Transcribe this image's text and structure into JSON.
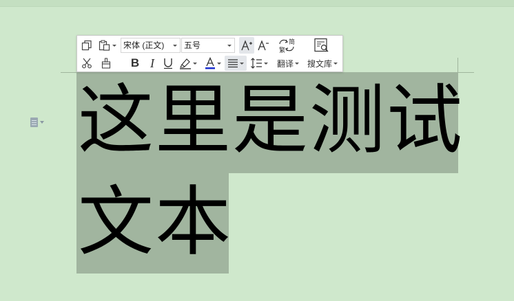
{
  "document": {
    "line1": "这里是测试",
    "line2": "文本"
  },
  "toolbar": {
    "font_name": "宋体 (正文)",
    "font_size": "五号",
    "translate_label": "翻译",
    "search_library_label": "搜文库"
  },
  "colors": {
    "page_background": "#cfe8cc",
    "selection_highlight": "#a1b59f",
    "font_color_bar": "#1b2fd0",
    "toolbar_background": "#ffffff"
  }
}
